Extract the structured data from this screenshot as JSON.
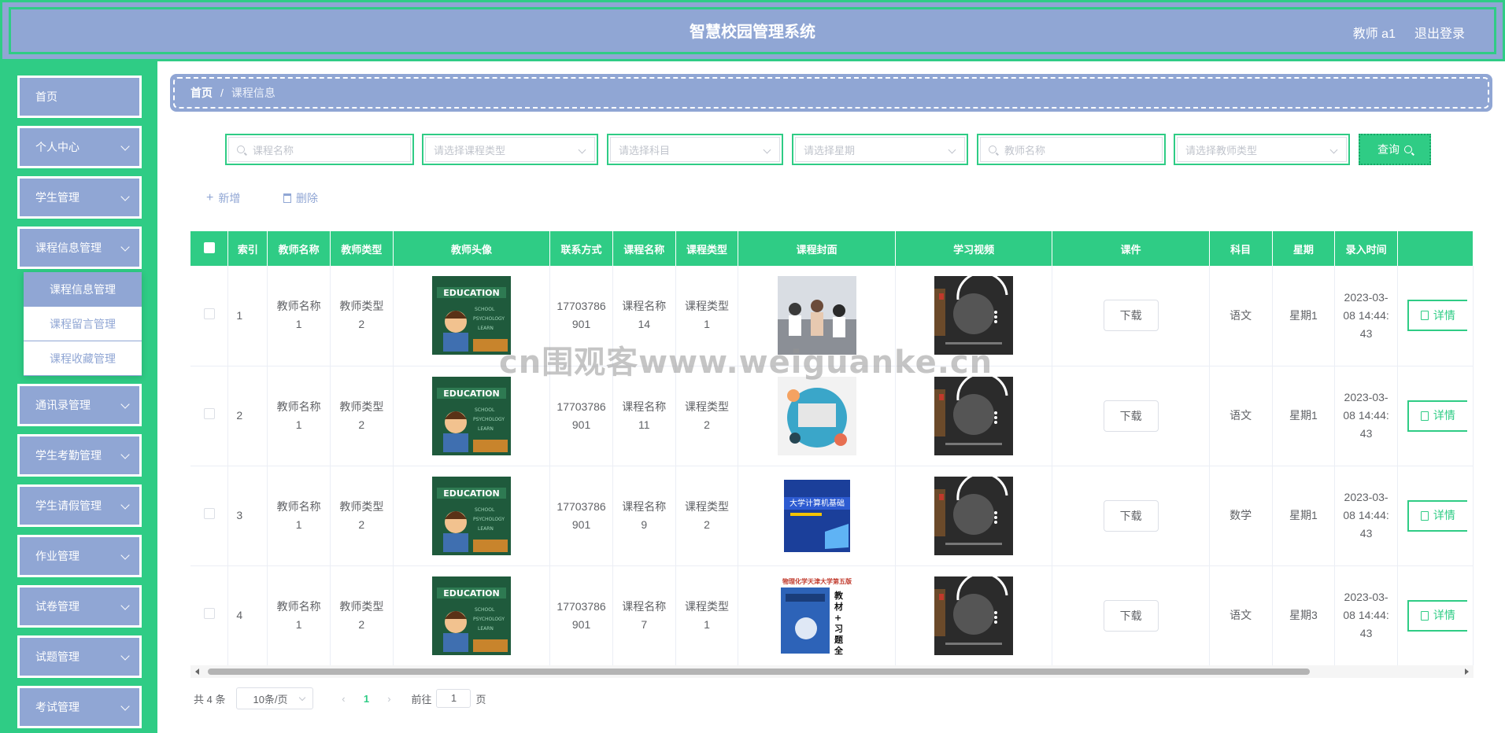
{
  "header": {
    "title": "智慧校园管理系统",
    "user": "教师 a1",
    "logout": "退出登录"
  },
  "sidebar": {
    "items": [
      {
        "label": "首页",
        "chevron": false
      },
      {
        "label": "个人中心",
        "chevron": true
      },
      {
        "label": "学生管理",
        "chevron": true
      },
      {
        "label": "课程信息管理",
        "chevron": true
      },
      {
        "label": "通讯录管理",
        "chevron": true
      },
      {
        "label": "学生考勤管理",
        "chevron": true
      },
      {
        "label": "学生请假管理",
        "chevron": true
      },
      {
        "label": "作业管理",
        "chevron": true
      },
      {
        "label": "试卷管理",
        "chevron": true
      },
      {
        "label": "试题管理",
        "chevron": true
      },
      {
        "label": "考试管理",
        "chevron": true
      }
    ],
    "submenu": [
      "课程信息管理",
      "课程留言管理",
      "课程收藏管理"
    ]
  },
  "breadcrumb": {
    "home": "首页",
    "sep": "/",
    "current": "课程信息"
  },
  "search": {
    "course_name": "课程名称",
    "course_type": "请选择课程类型",
    "subject": "请选择科目",
    "weekday": "请选择星期",
    "teacher_name": "教师名称",
    "teacher_type": "请选择教师类型",
    "query": "查询"
  },
  "actions": {
    "add": "新增",
    "delete": "删除"
  },
  "table": {
    "headers": [
      "索引",
      "教师名称",
      "教师类型",
      "教师头像",
      "联系方式",
      "课程名称",
      "课程类型",
      "课程封面",
      "学习视频",
      "课件",
      "科目",
      "星期",
      "录入时间"
    ],
    "download_label": "下载",
    "detail_label": "详情",
    "rows": [
      {
        "index": "1",
        "teacher": "教师名称1",
        "ttype": "教师类型2",
        "phone": "17703786901",
        "course": "课程名称14",
        "ctype": "课程类型1",
        "subject": "语文",
        "week": "星期1",
        "time": "2023-03-08 14:44:43"
      },
      {
        "index": "2",
        "teacher": "教师名称1",
        "ttype": "教师类型2",
        "phone": "17703786901",
        "course": "课程名称11",
        "ctype": "课程类型2",
        "subject": "语文",
        "week": "星期1",
        "time": "2023-03-08 14:44:43"
      },
      {
        "index": "3",
        "teacher": "教师名称1",
        "ttype": "教师类型2",
        "phone": "17703786901",
        "course": "课程名称9",
        "ctype": "课程类型2",
        "subject": "数学",
        "week": "星期1",
        "time": "2023-03-08 14:44:43"
      },
      {
        "index": "4",
        "teacher": "教师名称1",
        "ttype": "教师类型2",
        "phone": "17703786901",
        "course": "课程名称7",
        "ctype": "课程类型1",
        "subject": "语文",
        "week": "星期3",
        "time": "2023-03-08 14:44:43"
      }
    ]
  },
  "pagination": {
    "total": "共 4 条",
    "page_size": "10条/页",
    "current": "1",
    "goto": "前往",
    "goto_value": "1",
    "page_unit": "页"
  },
  "watermark": "cn围观客www.weiguanke.cn",
  "colors": {
    "primary": "#2fcc85",
    "secondary": "#90a6d4"
  }
}
